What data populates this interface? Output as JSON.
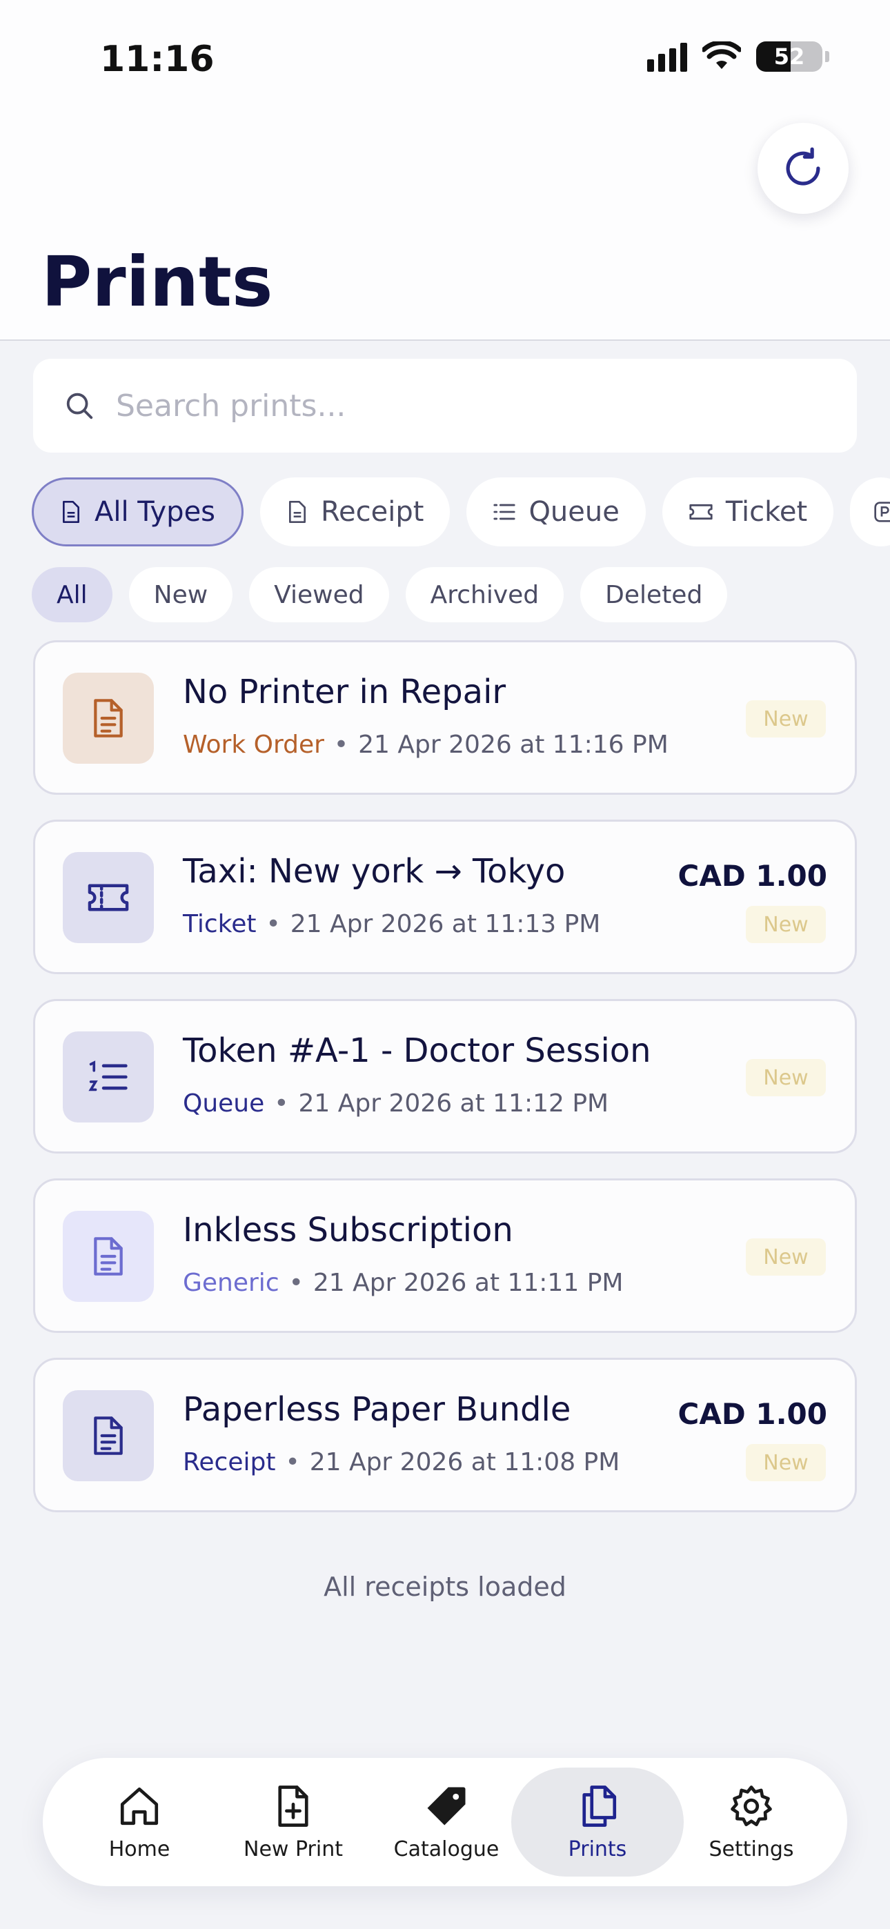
{
  "status_bar": {
    "time": "11:16",
    "battery": "52"
  },
  "header": {
    "title": "Prints"
  },
  "search": {
    "placeholder": "Search prints..."
  },
  "type_filters": [
    "All Types",
    "Receipt",
    "Queue",
    "Ticket"
  ],
  "status_filters": [
    "All",
    "New",
    "Viewed",
    "Archived",
    "Deleted"
  ],
  "prints": [
    {
      "title": "No Printer in Repair",
      "type": "Work Order",
      "date": "21 Apr 2026 at 11:16 PM",
      "amount": "",
      "badge": "New",
      "type_color": "#b5602a",
      "icon_bg": "#f0e2d8",
      "icon_color": "#b5602a",
      "icon": "document-icon"
    },
    {
      "title": "Taxi: New york → Tokyo",
      "type": "Ticket",
      "date": "21 Apr 2026 at 11:13 PM",
      "amount": "CAD 1.00",
      "badge": "New",
      "type_color": "#2a2c8c",
      "icon_bg": "#dfdff0",
      "icon_color": "#2a2c8c",
      "icon": "ticket-icon"
    },
    {
      "title": "Token #A-1 - Doctor Session",
      "type": "Queue",
      "date": "21 Apr 2026 at 11:12 PM",
      "amount": "",
      "badge": "New",
      "type_color": "#2a2c8c",
      "icon_bg": "#dfdff0",
      "icon_color": "#2a2c8c",
      "icon": "queue-list-icon"
    },
    {
      "title": "Inkless Subscription",
      "type": "Generic",
      "date": "21 Apr 2026 at 11:11 PM",
      "amount": "",
      "badge": "New",
      "type_color": "#6c6cd0",
      "icon_bg": "#e6e6fa",
      "icon_color": "#6c6cd0",
      "icon": "document-icon"
    },
    {
      "title": "Paperless Paper Bundle",
      "type": "Receipt",
      "date": "21 Apr 2026 at 11:08 PM",
      "amount": "CAD 1.00",
      "badge": "New",
      "type_color": "#2a2c8c",
      "icon_bg": "#dfdff0",
      "icon_color": "#2a2c8c",
      "icon": "document-icon"
    }
  ],
  "footer": {
    "text": "All receipts loaded"
  },
  "nav": [
    "Home",
    "New Print",
    "Catalogue",
    "Prints",
    "Settings"
  ]
}
